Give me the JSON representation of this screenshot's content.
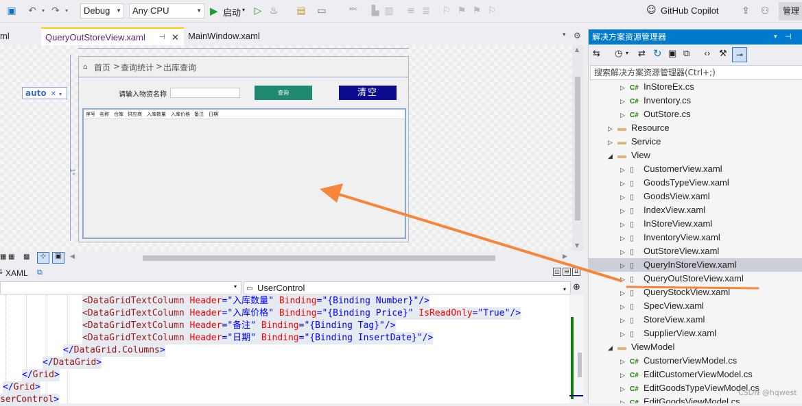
{
  "toolbar": {
    "config": "Debug",
    "platform": "Any CPU",
    "start_label": "启动",
    "copilot_label": "GitHub Copilot",
    "admin_label": "管理"
  },
  "tabs": [
    {
      "label": "ml"
    },
    {
      "label": "QueryOutStoreView.xaml"
    },
    {
      "label": "MainWindow.xaml"
    }
  ],
  "designer": {
    "auto_label": "auto",
    "star_label": "1*",
    "breadcrumb": {
      "home": "首页",
      "sep": ">",
      "section": "查询统计",
      "page": "出库查询"
    },
    "material_label": "请输入物资名称",
    "material_value": "",
    "query_button": "查询",
    "clear_button": "清空",
    "grid_columns": [
      "序号",
      "名称",
      "仓库",
      "供应商",
      "入库数量",
      "入库价格",
      "备注",
      "日期"
    ],
    "query_color": "#1f8a70",
    "clear_color": "#0b0b8f"
  },
  "bottom": {
    "xaml_tab": "XAML",
    "element_combo": "UserControl"
  },
  "code_lines": [
    {
      "indent": 120,
      "parts": [
        [
          "tag",
          "<DataGridTextColumn"
        ],
        [
          "attr",
          " Header"
        ],
        [
          "br",
          "=\""
        ],
        [
          "val",
          "入库数量"
        ],
        [
          "br",
          "\""
        ],
        [
          "attr",
          " Binding"
        ],
        [
          "br",
          "=\""
        ],
        [
          "val",
          "{Binding Number}"
        ],
        [
          "br",
          "\"/>"
        ]
      ]
    },
    {
      "indent": 120,
      "parts": [
        [
          "tag",
          "<DataGridTextColumn"
        ],
        [
          "attr",
          " Header"
        ],
        [
          "br",
          "=\""
        ],
        [
          "val",
          "入库价格"
        ],
        [
          "br",
          "\""
        ],
        [
          "attr",
          " Binding"
        ],
        [
          "br",
          "=\""
        ],
        [
          "val",
          "{Binding Price}"
        ],
        [
          "br",
          "\""
        ],
        [
          "attr",
          " IsReadOnly"
        ],
        [
          "br",
          "=\""
        ],
        [
          "val",
          "True"
        ],
        [
          "br",
          "\"/>"
        ]
      ]
    },
    {
      "indent": 120,
      "parts": [
        [
          "tag",
          "<DataGridTextColumn"
        ],
        [
          "attr",
          " Header"
        ],
        [
          "br",
          "=\""
        ],
        [
          "val",
          "备注"
        ],
        [
          "br",
          "\""
        ],
        [
          "attr",
          " Binding"
        ],
        [
          "br",
          "=\""
        ],
        [
          "val",
          "{Binding Tag}"
        ],
        [
          "br",
          "\"/>"
        ]
      ]
    },
    {
      "indent": 120,
      "parts": [
        [
          "tag",
          "<DataGridTextColumn"
        ],
        [
          "attr",
          " Header"
        ],
        [
          "br",
          "=\""
        ],
        [
          "val",
          "日期"
        ],
        [
          "br",
          "\""
        ],
        [
          "attr",
          " Binding"
        ],
        [
          "br",
          "=\""
        ],
        [
          "val",
          "{Binding InsertDate}"
        ],
        [
          "br",
          "\"/>"
        ]
      ]
    },
    {
      "indent": 92,
      "parts": [
        [
          "br",
          "</"
        ],
        [
          "tag",
          "DataGrid.Columns"
        ],
        [
          "br",
          ">"
        ]
      ]
    },
    {
      "indent": 62,
      "parts": [
        [
          "br",
          "</"
        ],
        [
          "tag",
          "DataGrid"
        ],
        [
          "br",
          ">"
        ]
      ]
    },
    {
      "indent": 32,
      "parts": [
        [
          "br",
          "</"
        ],
        [
          "tag",
          "Grid"
        ],
        [
          "br",
          ">"
        ]
      ]
    },
    {
      "indent": 4,
      "parts": [
        [
          "br",
          "</"
        ],
        [
          "tag",
          "Grid"
        ],
        [
          "br",
          ">"
        ]
      ]
    },
    {
      "indent": 0,
      "parts": [
        [
          "tag",
          "serControl"
        ],
        [
          "br",
          ">"
        ]
      ]
    }
  ],
  "solution_explorer": {
    "title": "解决方案资源管理器",
    "search_placeholder": "搜索解决方案资源管理器(Ctrl+;)",
    "items": [
      {
        "label": "InStoreEx.cs",
        "kind": "cs",
        "level": 2,
        "exp": "▷"
      },
      {
        "label": "Inventory.cs",
        "kind": "cs",
        "level": 2,
        "exp": "▷"
      },
      {
        "label": "OutStore.cs",
        "kind": "cs",
        "level": 2,
        "exp": "▷"
      },
      {
        "label": "Resource",
        "kind": "folder",
        "level": 1,
        "exp": "▷"
      },
      {
        "label": "Service",
        "kind": "folder",
        "level": 1,
        "exp": "▷"
      },
      {
        "label": "View",
        "kind": "folder-open",
        "level": 1,
        "exp": "◢"
      },
      {
        "label": "CustomerView.xaml",
        "kind": "xaml",
        "level": 2,
        "exp": "▷"
      },
      {
        "label": "GoodsTypeView.xaml",
        "kind": "xaml",
        "level": 2,
        "exp": "▷"
      },
      {
        "label": "GoodsView.xaml",
        "kind": "xaml",
        "level": 2,
        "exp": "▷"
      },
      {
        "label": "IndexView.xaml",
        "kind": "xaml",
        "level": 2,
        "exp": "▷"
      },
      {
        "label": "InStoreView.xaml",
        "kind": "xaml",
        "level": 2,
        "exp": "▷"
      },
      {
        "label": "InventoryView.xaml",
        "kind": "xaml",
        "level": 2,
        "exp": "▷"
      },
      {
        "label": "OutStoreView.xaml",
        "kind": "xaml",
        "level": 2,
        "exp": "▷"
      },
      {
        "label": "QueryInStoreView.xaml",
        "kind": "xaml",
        "level": 2,
        "exp": "▷",
        "selected": true
      },
      {
        "label": "QueryOutStoreView.xaml",
        "kind": "xaml",
        "level": 2,
        "exp": "▷",
        "underlined": true
      },
      {
        "label": "QueryStockView.xaml",
        "kind": "xaml",
        "level": 2,
        "exp": "▷"
      },
      {
        "label": "SpecView.xaml",
        "kind": "xaml",
        "level": 2,
        "exp": "▷"
      },
      {
        "label": "StoreView.xaml",
        "kind": "xaml",
        "level": 2,
        "exp": "▷"
      },
      {
        "label": "SupplierView.xaml",
        "kind": "xaml",
        "level": 2,
        "exp": "▷"
      },
      {
        "label": "ViewModel",
        "kind": "folder-open",
        "level": 1,
        "exp": "◢"
      },
      {
        "label": "CustomerViewModel.cs",
        "kind": "cs",
        "level": 2,
        "exp": "▷"
      },
      {
        "label": "EditCustomerViewModel.cs",
        "kind": "cs",
        "level": 2,
        "exp": "▷"
      },
      {
        "label": "EditGoodsTypeViewModel.cs",
        "kind": "cs",
        "level": 2,
        "exp": "▷"
      },
      {
        "label": "EditGoodsViewModel.cs",
        "kind": "cs",
        "level": 2,
        "exp": "▷"
      }
    ]
  },
  "watermark": "CSDN @hqwest",
  "annotation_color": "#f5863c"
}
